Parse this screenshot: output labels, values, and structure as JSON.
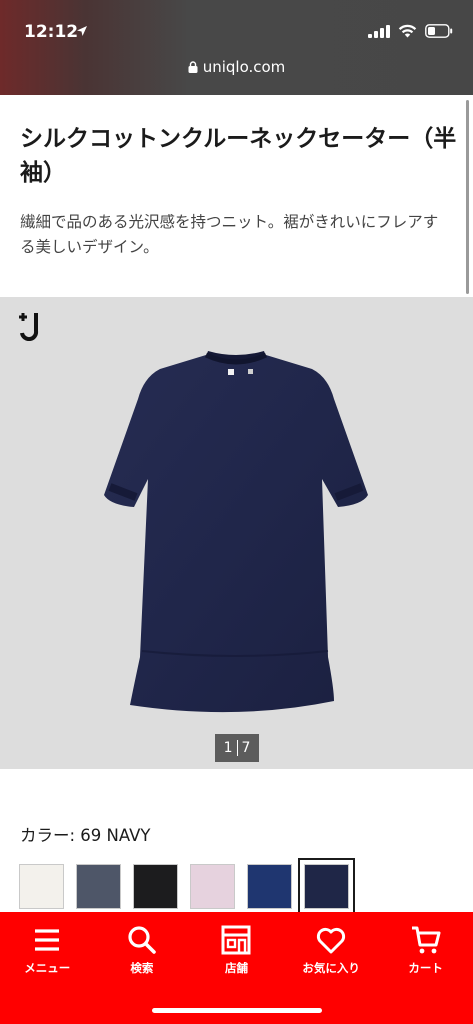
{
  "status_bar": {
    "time": "12:12"
  },
  "browser": {
    "url": "uniqlo.com"
  },
  "product": {
    "title": "シルクコットンクルーネックセーター（半袖）",
    "description": "繊細で品のある光沢感を持つニット。裾がきれいにフレアする美しいデザイン。",
    "brand_mark": "+J",
    "gallery": {
      "current_image": "1",
      "total_images": "7"
    }
  },
  "color": {
    "label": "カラー: 69 NAVY",
    "selected_index": 5,
    "swatches": [
      {
        "name": "off-white",
        "hex": "#f3f1ec"
      },
      {
        "name": "gray-blue",
        "hex": "#4e5668"
      },
      {
        "name": "black",
        "hex": "#1c1c1e"
      },
      {
        "name": "pink",
        "hex": "#e6d2de"
      },
      {
        "name": "blue",
        "hex": "#1f3670"
      },
      {
        "name": "navy",
        "hex": "#1f2647"
      }
    ]
  },
  "bottom_nav": {
    "items": [
      {
        "label": "メニュー",
        "icon": "menu-icon"
      },
      {
        "label": "検索",
        "icon": "search-icon"
      },
      {
        "label": "店舗",
        "icon": "store-icon"
      },
      {
        "label": "お気に入り",
        "icon": "heart-icon"
      },
      {
        "label": "カート",
        "icon": "cart-icon"
      }
    ]
  },
  "colors": {
    "brand_red": "#ff0000",
    "gallery_bg": "#dddddd",
    "garment_navy": "#22274a"
  }
}
